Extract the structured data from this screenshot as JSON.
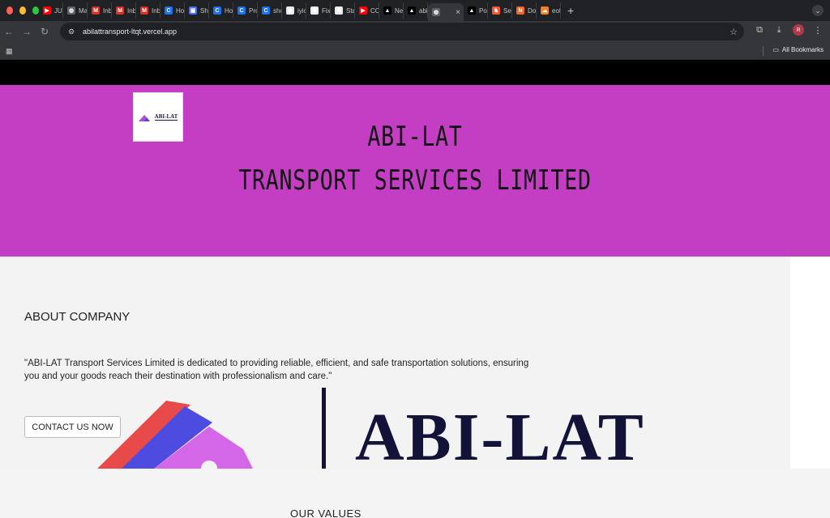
{
  "browser": {
    "tabs": [
      {
        "label": "JUS",
        "icon": "youtube-icon",
        "color": "#ff0000"
      },
      {
        "label": "Man",
        "icon": "globe-icon",
        "color": "#5f6368"
      },
      {
        "label": "Inbo",
        "icon": "gmail-icon",
        "color": "#d93025"
      },
      {
        "label": "Inbo",
        "icon": "gmail-icon",
        "color": "#d93025"
      },
      {
        "label": "Inbo",
        "icon": "gmail-icon",
        "color": "#d93025"
      },
      {
        "label": "Hon",
        "icon": "c-icon",
        "color": "#1a73e8"
      },
      {
        "label": "Sho",
        "icon": "image-icon",
        "color": "#4a6cf7"
      },
      {
        "label": "Hon",
        "icon": "c-icon",
        "color": "#1a73e8"
      },
      {
        "label": "Proj",
        "icon": "c-icon",
        "color": "#1a73e8"
      },
      {
        "label": "shol",
        "icon": "c-icon",
        "color": "#1a73e8"
      },
      {
        "label": "iyiol",
        "icon": "github-icon",
        "color": "#e8eaed"
      },
      {
        "label": "Fixi",
        "icon": "openai-icon",
        "color": "#e8eaed"
      },
      {
        "label": "Star",
        "icon": "openai-icon",
        "color": "#e8eaed"
      },
      {
        "label": "COI",
        "icon": "youtube-icon",
        "color": "#ff0000"
      },
      {
        "label": "New",
        "icon": "vercel-icon",
        "color": "#000000"
      },
      {
        "label": "abili",
        "icon": "vercel-icon",
        "color": "#000000"
      }
    ],
    "active_tab": {
      "label": "",
      "icon": "globe-icon"
    },
    "tabs_after": [
      {
        "label": "Port",
        "icon": "vercel-icon",
        "color": "#000000"
      },
      {
        "label": "Sea",
        "icon": "brave-icon",
        "color": "#fb542b"
      },
      {
        "label": "Don",
        "icon": "n-icon",
        "color": "#f26522"
      },
      {
        "label": "eofc",
        "icon": "cloud-icon",
        "color": "#f38020"
      }
    ],
    "url": "abilattransport-ltqt.vercel.app",
    "all_bookmarks": "All Bookmarks",
    "profile_initial": "R"
  },
  "site": {
    "logo_text": "ABI-LAT",
    "hero_line1": "ABI-LAT",
    "hero_line2": "TRANSPORT SERVICES LIMITED",
    "about_heading": "ABOUT COMPANY",
    "about_text": "\"ABI-LAT Transport Services Limited is dedicated to providing reliable, efficient, and safe transportation solutions, ensuring you and your goods reach their destination with professionalism and care.\"",
    "contact_button": "CONTACT US NOW",
    "brand_graphic_text": "ABI-LAT",
    "values_heading": "OUR VALUES"
  },
  "colors": {
    "hero_bg": "#c43ec4",
    "topbar": "#000000",
    "brand_navy": "#13133a"
  }
}
